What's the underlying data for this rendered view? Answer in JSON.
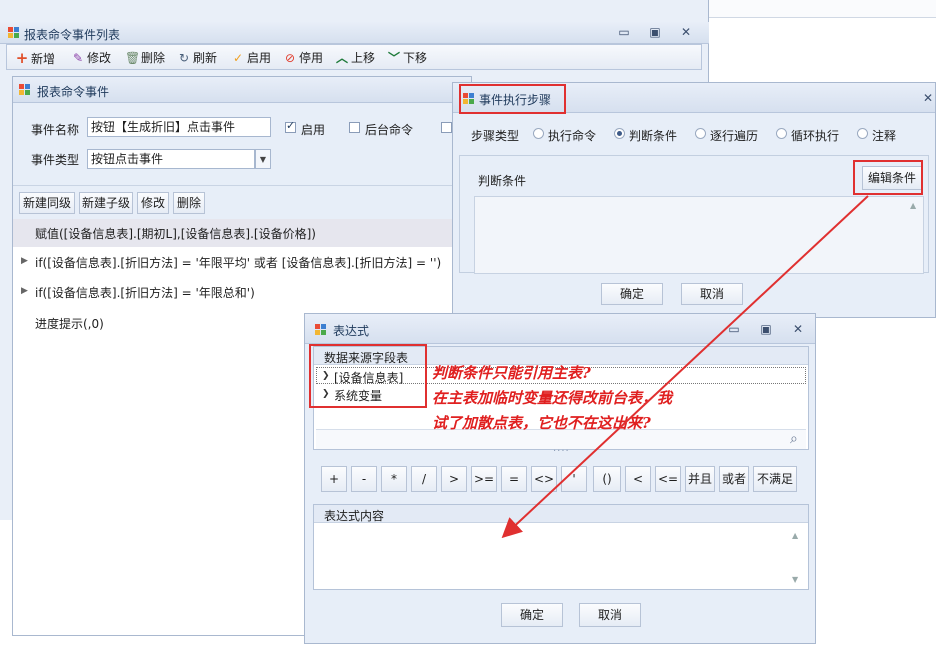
{
  "main_window": {
    "title": "报表命令事件列表",
    "controls": {
      "minimize": "▭",
      "restore": "▣",
      "close": "✕"
    },
    "toolbar": {
      "add": "新增",
      "edit": "修改",
      "delete": "删除",
      "refresh": "刷新",
      "enable": "启用",
      "disable": "停用",
      "move_up": "上移",
      "move_down": "下移"
    }
  },
  "event_panel": {
    "title": "报表命令事件",
    "name_label": "事件名称",
    "name_value": "按钮【生成折旧】点击事件",
    "enabled_label": "启用",
    "enabled": true,
    "background_label": "后台命令",
    "background": false,
    "type_label": "事件类型",
    "type_value": "按钮点击事件",
    "buttons": {
      "new_sibling": "新建同级",
      "new_child": "新建子级",
      "modify": "修改",
      "remove": "删除"
    },
    "tree": [
      "赋值([设备信息表].[期初L],[设备信息表].[设备价格])",
      "if([设备信息表].[折旧方法] = '年限平均' 或者 [设备信息表].[折旧方法] = '')",
      "if([设备信息表].[折旧方法] = '年限总和')",
      "进度提示(,0)"
    ]
  },
  "step_dialog": {
    "title": "事件执行步骤",
    "close": "✕",
    "step_type_label": "步骤类型",
    "options": [
      "执行命令",
      "判断条件",
      "逐行遍历",
      "循环执行",
      "注释"
    ],
    "selected_index": 1,
    "condition_label": "判断条件",
    "edit_button": "编辑条件",
    "ok": "确定",
    "cancel": "取消"
  },
  "expr_dialog": {
    "title": "表达式",
    "controls": {
      "minimize": "▭",
      "restore": "▣",
      "close": "✕"
    },
    "source_label": "数据来源字段表",
    "items": [
      "[设备信息表]",
      "系统变量"
    ],
    "operators": [
      "+",
      "-",
      "*",
      "/",
      ">",
      ">=",
      "=",
      "<>",
      "'",
      "()",
      "<",
      "<=",
      "并且",
      "或者",
      "不满足"
    ],
    "content_label": "表达式内容",
    "ok": "确定",
    "cancel": "取消"
  },
  "annotation": {
    "line1": "判断条件只能引用主表?",
    "line2": "在主表加临时变量还得改前台表，我",
    "line3": "试了加散点表，它也不在这出来?"
  },
  "colors": {
    "accent_red": "#e03030",
    "title_bar": "#dde6f3",
    "panel_bg": "#e7eef8"
  }
}
